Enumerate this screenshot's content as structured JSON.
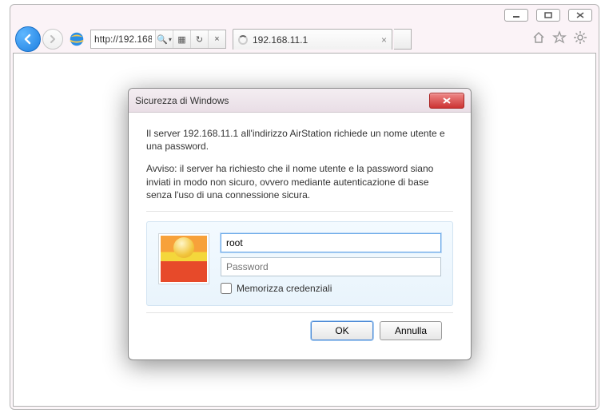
{
  "browser": {
    "address_value": "http://192.168...",
    "tab_title": "192.168.11.1"
  },
  "window_controls": {
    "minimize": "minimize",
    "maximize": "maximize",
    "close": "close"
  },
  "toolbar_icons": {
    "search": "🔍",
    "refresh": "↻",
    "stop": "×",
    "compat": "📄",
    "dropdown": "▾",
    "home": "⌂",
    "favorites": "☆",
    "tools": "⚙"
  },
  "dialog": {
    "title": "Sicurezza di Windows",
    "line1": "Il server 192.168.11.1 all'indirizzo AirStation richiede un nome utente e una password.",
    "line2": "Avviso: il server ha richiesto che il nome utente e la password siano inviati in modo non sicuro, ovvero mediante autenticazione di base senza l'uso di una connessione sicura.",
    "username_value": "root",
    "password_placeholder": "Password",
    "remember_label": "Memorizza credenziali",
    "ok_label": "OK",
    "cancel_label": "Annulla"
  }
}
